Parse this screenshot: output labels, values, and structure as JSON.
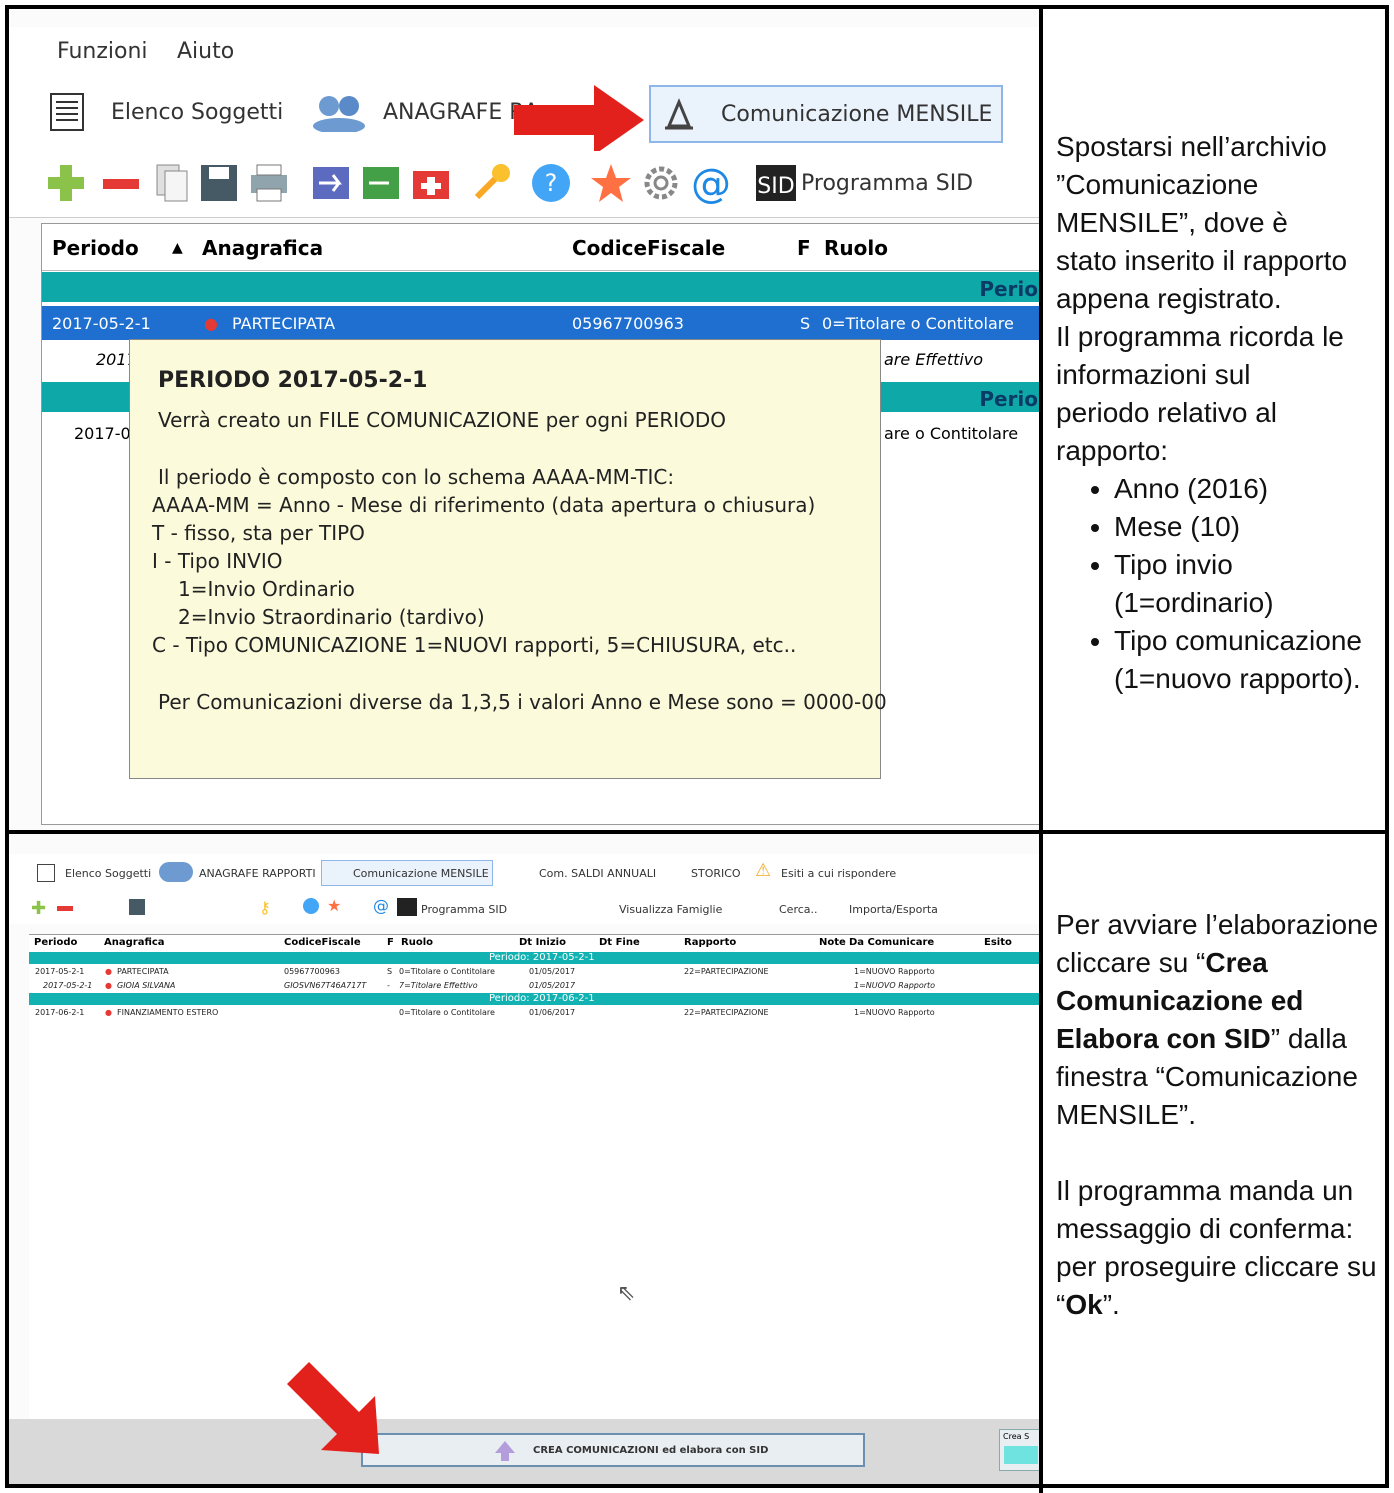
{
  "top_shot": {
    "menu": [
      "Funzioni",
      "Aiuto"
    ],
    "tabs": [
      "Elenco Soggetti",
      "ANAGRAFE RA",
      "Comunicazione MENSILE"
    ],
    "toolbar_sid_label": "Programma SID",
    "grid_headers": [
      "Periodo",
      "Anagrafica",
      "CodiceFiscale",
      "F",
      "Ruolo"
    ],
    "group_label": "Perio",
    "row1": {
      "periodo": "2017-05-2-1",
      "anagrafica": "PARTECIPATA",
      "cf": "05967700963",
      "f": "S",
      "ruolo": "0=Titolare o Contitolare"
    },
    "row2": {
      "periodo": "2017",
      "ruolo": "are Effettivo"
    },
    "group2_label": "Perio",
    "row3": {
      "periodo": "2017-0",
      "ruolo": "are o Contitolare"
    },
    "tooltip": {
      "title": "PERIODO 2017-05-2-1",
      "lines": [
        "Verrà creato un FILE COMUNICAZIONE per ogni PERIODO",
        "Il periodo è composto con lo schema AAAA-MM-TIC:",
        "AAAA-MM = Anno - Mese di riferimento (data apertura o chiusura)",
        "T - fisso, sta per TIPO",
        "I - Tipo INVIO",
        "1=Invio Ordinario",
        "2=Invio Straordinario (tardivo)",
        "C - Tipo COMUNICAZIONE 1=NUOVI rapporti, 5=CHIUSURA,  etc..",
        "Per Comunicazioni diverse da 1,3,5 i valori Anno e Mese sono = 0000-00"
      ]
    }
  },
  "instructions_1": {
    "intro": [
      "Spostarsi nell’archivio",
      "”Comunicazione",
      "MENSILE”, dove è",
      "stato inserito il rapporto",
      "appena registrato.",
      "Il programma ricorda le",
      "informazioni sul",
      "periodo relativo al",
      "rapporto:"
    ],
    "bullets": [
      "Anno (2016)",
      "Mese (10)",
      "Tipo invio (1=ordinario)",
      "Tipo comunicazione (1=nuovo rapporto)."
    ]
  },
  "bottom_shot": {
    "tabs": [
      "Elenco Soggetti",
      "ANAGRAFE RAPPORTI",
      "Comunicazione MENSILE",
      "Com. SALDI ANNUALI",
      "STORICO",
      "Esiti a cui rispondere"
    ],
    "toolbar": [
      "Programma SID",
      "Visualizza Famiglie",
      "Cerca..",
      "Importa/Esporta"
    ],
    "headers": [
      "Periodo",
      "Anagrafica",
      "CodiceFiscale",
      "F",
      "Ruolo",
      "Dt Inizio",
      "Dt Fine",
      "Rapporto",
      "Note",
      "Da Comunicare",
      "Esito"
    ],
    "group1": "Periodo: 2017-05-2-1",
    "rows1": [
      [
        "2017-05-2-1",
        "PARTECIPATA",
        "05967700963",
        "S",
        "0=Titolare o Contitolare",
        "01/05/2017",
        "",
        "22=PARTECIPAZIONE",
        "1=NUOVO Rapporto"
      ],
      [
        "2017-05-2-1",
        "GIOIA SILVANA",
        "GIOSVN67T46A717T",
        "-",
        "7=Titolare Effettivo",
        "01/05/2017",
        "",
        "",
        "1=NUOVO Rapporto"
      ]
    ],
    "group2": "Periodo: 2017-06-2-1",
    "rows2": [
      [
        "2017-06-2-1",
        "FINANZIAMENTO ESTERO",
        "",
        "",
        "0=Titolare o Contitolare",
        "01/06/2017",
        "",
        "22=PARTECIPAZIONE",
        "1=NUOVO Rapporto"
      ]
    ],
    "button": "CREA COMUNICAZIONI ed elabora con SID",
    "side_label": "Crea S"
  },
  "instructions_2": {
    "p1_pre": "Per avviare l’elaborazione cliccare su “",
    "p1_bold": "Crea Comunicazione ed Elabora con SID",
    "p1_post": "” dalla finestra “Comunicazione MENSILE”.",
    "p2_pre": "Il programma manda un messaggio di conferma: per proseguire cliccare su “",
    "p2_bold": "Ok",
    "p2_post": "”."
  }
}
